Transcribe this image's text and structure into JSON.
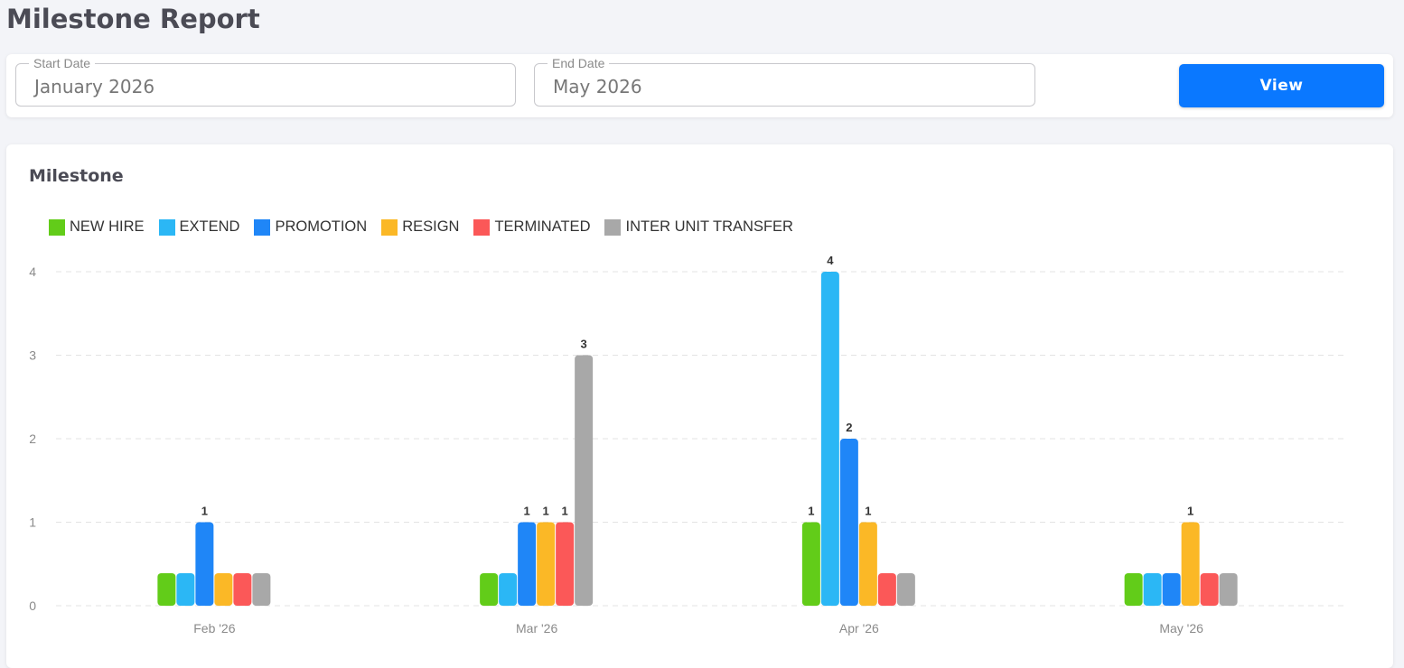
{
  "page": {
    "title": "Milestone Report"
  },
  "filters": {
    "start_label": "Start Date",
    "start_value": "January 2026",
    "end_label": "End Date",
    "end_value": "May 2026",
    "view_label": "View"
  },
  "chart_card": {
    "title": "Milestone"
  },
  "chart_data": {
    "type": "bar",
    "title": "Milestone",
    "xlabel": "",
    "ylabel": "",
    "ylim": [
      0,
      4
    ],
    "yticks": [
      0,
      1,
      2,
      3,
      4
    ],
    "grid": true,
    "legend_position": "top-left",
    "categories": [
      "Feb '26",
      "Mar '26",
      "Apr '26",
      "May '26"
    ],
    "series": [
      {
        "name": "NEW HIRE",
        "color": "#62cc19",
        "values": [
          0,
          0,
          1,
          0
        ]
      },
      {
        "name": "EXTEND",
        "color": "#2bb7f5",
        "values": [
          0,
          0,
          4,
          0
        ]
      },
      {
        "name": "PROMOTION",
        "color": "#1f86f7",
        "values": [
          1,
          1,
          2,
          0
        ]
      },
      {
        "name": "RESIGN",
        "color": "#fbb826",
        "values": [
          0,
          1,
          1,
          1
        ]
      },
      {
        "name": "TERMINATED",
        "color": "#fb5858",
        "values": [
          0,
          1,
          0,
          0
        ]
      },
      {
        "name": "INTER UNIT TRANSFER",
        "color": "#a8a8a8",
        "values": [
          0,
          3,
          0,
          0
        ]
      }
    ]
  }
}
